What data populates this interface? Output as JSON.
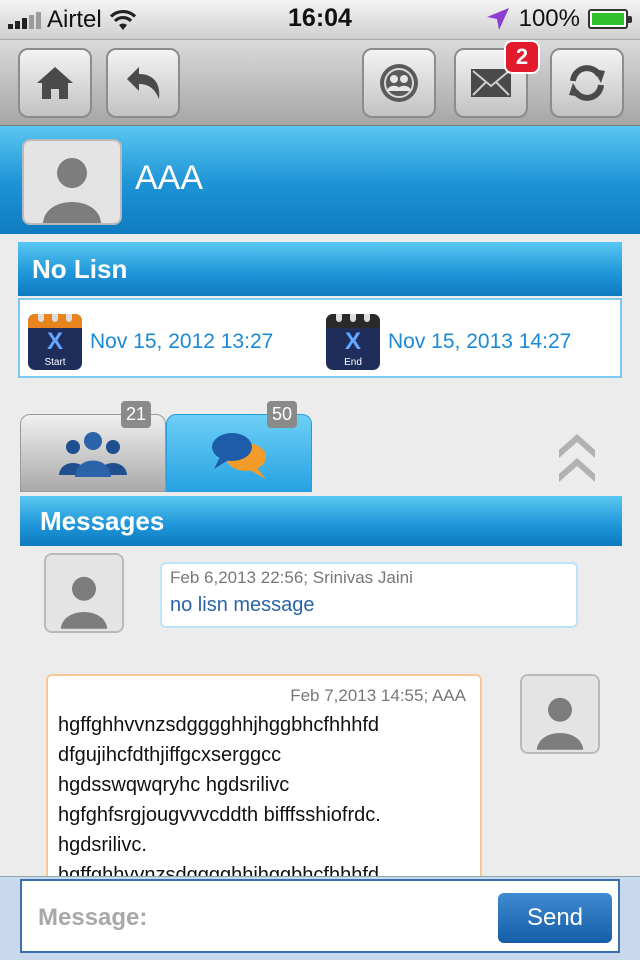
{
  "status_bar": {
    "carrier": "Airtel",
    "time": "16:04",
    "battery": "100%"
  },
  "toolbar": {
    "home": "home-icon",
    "back": "back-icon",
    "groups": "group-target-icon",
    "mail": "mail-icon",
    "mail_badge": "2",
    "refresh": "refresh-icon"
  },
  "profile": {
    "name": "AAA"
  },
  "lisn": {
    "title": "No Lisn",
    "start_label": "Start",
    "end_label": "End",
    "start_date": "Nov 15, 2012  13:27",
    "end_date": "Nov 15, 2013  14:27"
  },
  "tabs": [
    {
      "icon": "people-icon",
      "count": "21"
    },
    {
      "icon": "chat-bubbles-icon",
      "count": "50"
    }
  ],
  "messages_section": {
    "title": "Messages",
    "items": [
      {
        "meta": "Feb 6,2013 22:56; Srinivas Jaini",
        "text": "no lisn message"
      },
      {
        "meta": "Feb 7,2013 14:55; AAA",
        "lines": [
          "hgffghhvvnzsdgggghhjhggbhcfhhhfd",
          "dfgujihcfdthjiffgcxserggcc",
          "hgdsswqwqryhc hgdsrilivc",
          "hgfghfsrgjougvvvcddth bifffsshiofrdc.",
          "hgdsrilivc.",
          "hgffghhvvnzsdgggghhjhggbhcfhhhfd"
        ]
      }
    ]
  },
  "composer": {
    "placeholder": "Message:",
    "send": "Send"
  },
  "colors": {
    "accent": "#1e94d7",
    "badge": "#e21b2c",
    "own_bubble_border": "#f7c896"
  }
}
